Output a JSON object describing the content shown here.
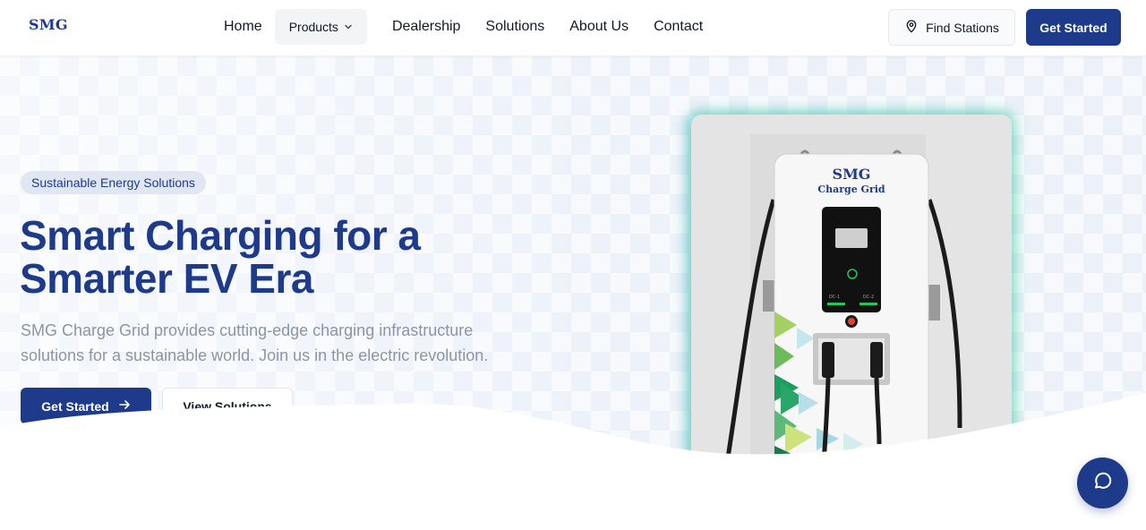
{
  "brand": {
    "logo_text": "SMG",
    "primary_color": "#1e3a8a"
  },
  "nav": {
    "home": "Home",
    "products": "Products",
    "dealership": "Dealership",
    "solutions": "Solutions",
    "about": "About Us",
    "contact": "Contact"
  },
  "header_actions": {
    "find_stations": "Find Stations",
    "find_stations_icon": "map-pin-icon",
    "get_started": "Get Started"
  },
  "hero": {
    "badge": "Sustainable Energy Solutions",
    "headline_line1": "Smart Charging for a",
    "headline_line2": "Smarter EV Era",
    "subtext": "SMG Charge Grid provides cutting-edge charging infrastructure solutions for a sustainable world. Join us in the electric revolution.",
    "primary_cta": "Get Started",
    "primary_cta_icon": "arrow-right-icon",
    "secondary_cta": "View Solutions"
  },
  "product_image": {
    "brand_text": "SMG",
    "model_text": "Charge Grid",
    "left_port_label": "DC-1",
    "right_port_label": "DC-2"
  },
  "chat": {
    "icon": "chat-bubble-icon"
  }
}
